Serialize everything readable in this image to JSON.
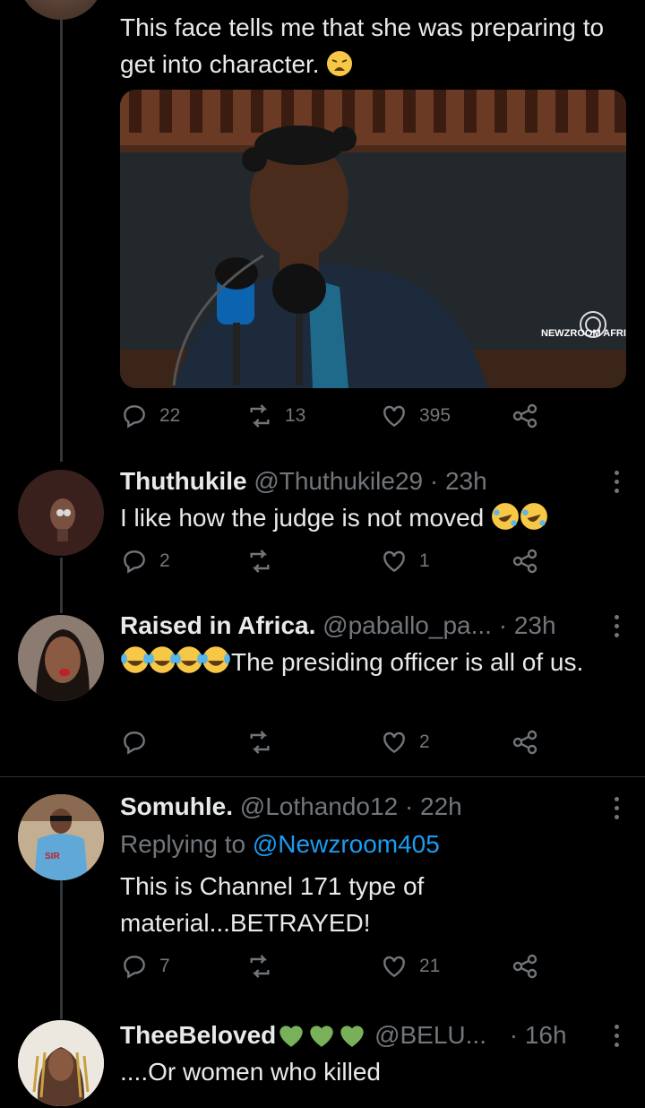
{
  "tweets": [
    {
      "text": "This face tells me that she was preparing to get into character.",
      "media_watermark": "NEWZROOM AFRIKA",
      "replies": "22",
      "retweets": "13",
      "likes": "395"
    },
    {
      "name": "Thuthukile",
      "handle": "@Thuthukile29",
      "time": "· 23h",
      "text": "I like how the judge is not moved",
      "replies": "2",
      "retweets": "",
      "likes": "1"
    },
    {
      "name": "Raised in Africa.",
      "handle": "@paballo_pa...",
      "time": "· 23h",
      "text": "The presiding officer is all of us.",
      "replies": "",
      "retweets": "",
      "likes": "2"
    },
    {
      "name": "Somuhle.",
      "handle": "@Lothando12",
      "time": "· 22h",
      "replying_prefix": "Replying to ",
      "replying_to": "@Newzroom405",
      "text_line1": "This is Channel 171 type of",
      "text_line2": "material...BETRAYED!",
      "replies": "7",
      "retweets": "",
      "likes": "21"
    },
    {
      "name": "TheeBeloved",
      "handle": "@BELU...",
      "time": "· 16h",
      "text": "....Or women who killed"
    }
  ],
  "colors": {
    "background": "#000000",
    "text": "#e7e9ea",
    "muted": "#71767b",
    "link": "#1d9bf0",
    "heart": "#78b159"
  },
  "icons": [
    "reply-icon",
    "retweet-icon",
    "like-icon",
    "share-icon",
    "more-icon"
  ]
}
